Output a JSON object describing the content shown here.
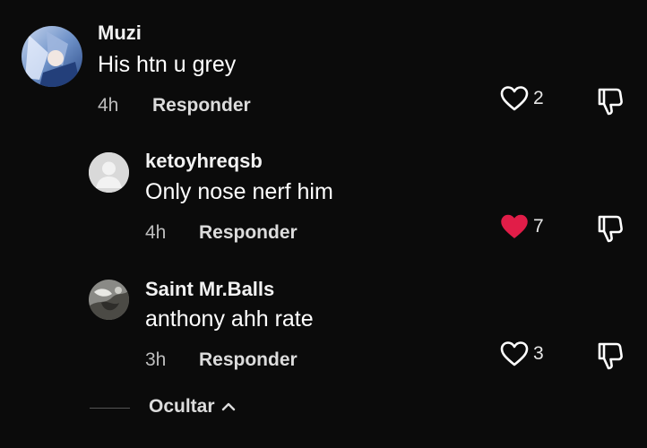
{
  "comments": [
    {
      "username": "Muzi",
      "text": "His htn u grey",
      "time": "4h",
      "reply_label": "Responder",
      "likes": "2",
      "liked": false
    },
    {
      "username": "ketoyhreqsb",
      "text": "Only nose nerf him",
      "time": "4h",
      "reply_label": "Responder",
      "likes": "7",
      "liked": true
    },
    {
      "username": "Saint Mr.Balls",
      "text": "anthony ahh rate",
      "time": "3h",
      "reply_label": "Responder",
      "likes": "3",
      "liked": false
    }
  ],
  "hide_replies": {
    "label": "Ocultar",
    "icon": "chevron-up-icon"
  },
  "colors": {
    "background": "#0b0b0b",
    "liked_heart": "#e11d48",
    "secondary_text": "#bdbdbd"
  }
}
